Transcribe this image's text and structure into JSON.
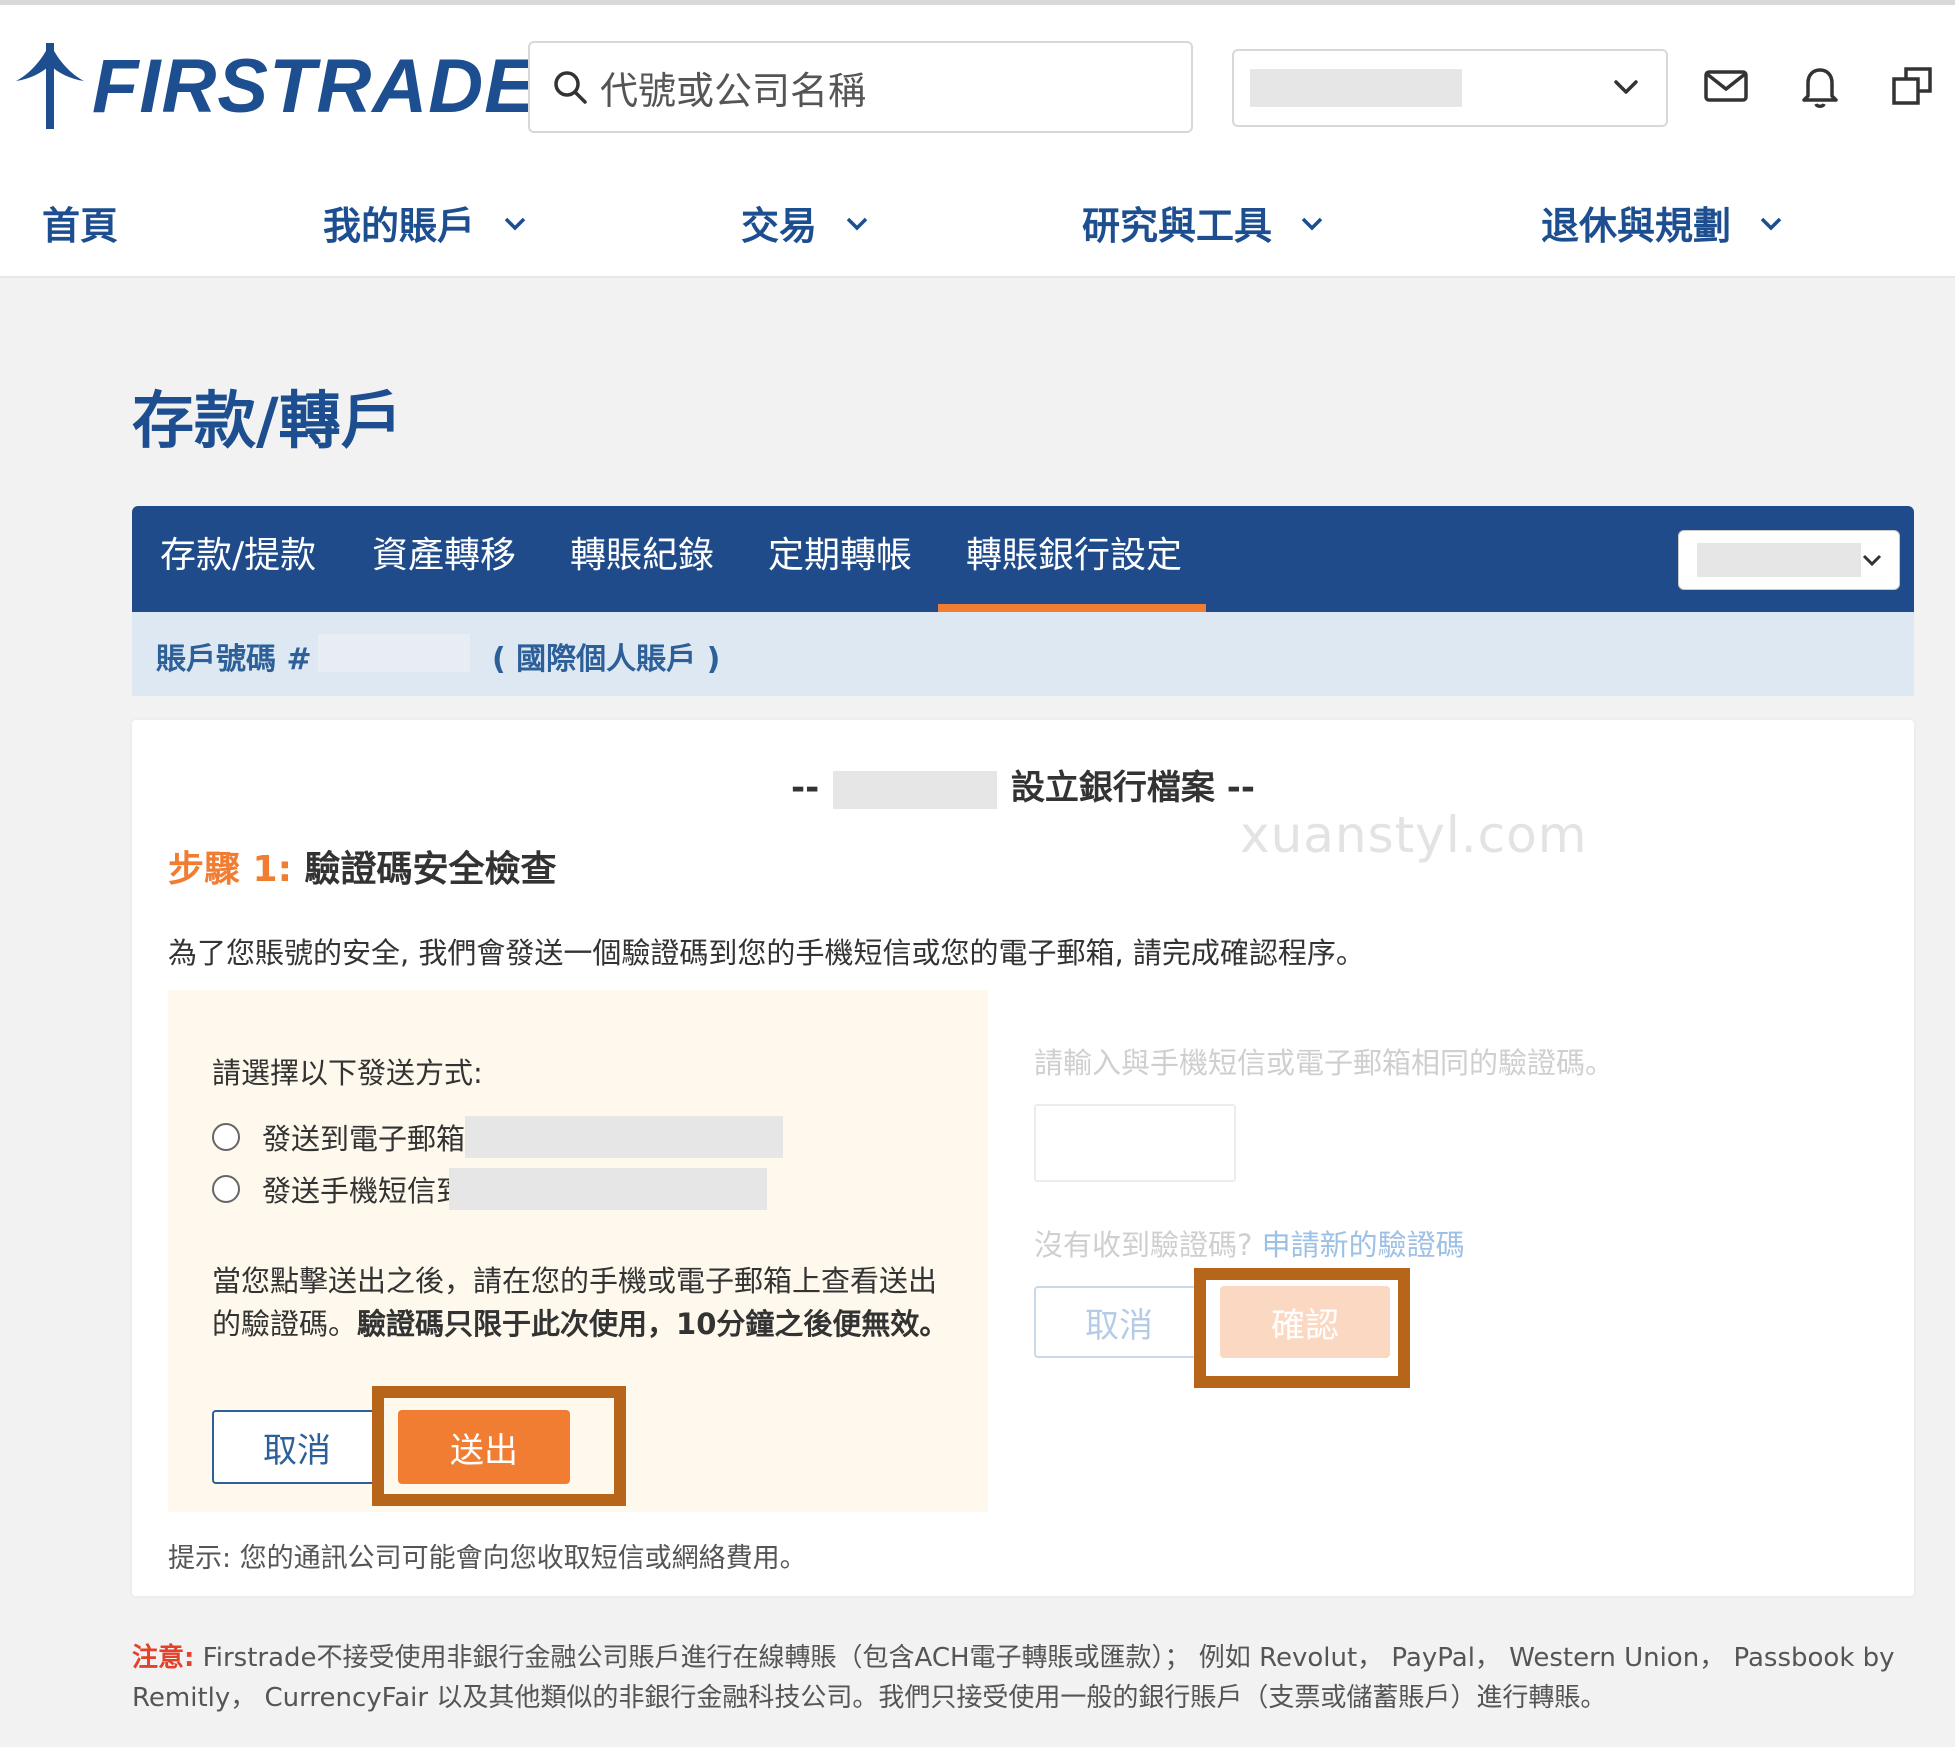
{
  "header": {
    "brand": "FIRSTRADE",
    "search_placeholder": "代號或公司名稱",
    "icons": [
      "search-icon",
      "chevron-down-icon",
      "mail-icon",
      "bell-icon",
      "external-window-icon"
    ]
  },
  "nav": [
    {
      "label": "首頁"
    },
    {
      "label": "我的賬戶"
    },
    {
      "label": "交易"
    },
    {
      "label": "研究與工具"
    },
    {
      "label": "退休與規劃"
    }
  ],
  "page": {
    "title": "存款/轉戶"
  },
  "tabs": [
    {
      "label": "存款/提款"
    },
    {
      "label": "資產轉移"
    },
    {
      "label": "轉賬紀錄"
    },
    {
      "label": "定期轉帳"
    },
    {
      "label": "轉賬銀行設定",
      "active": true
    }
  ],
  "account": {
    "label": "賬戶號碼 #",
    "type": "( 國際個人賬戶 )"
  },
  "card": {
    "heading_prefix": "--",
    "heading_suffix": "設立銀行檔案 --",
    "watermark": "xuanstyl.com",
    "step_num": "步驟 1:",
    "step_title": "驗證碼安全檢查",
    "description": "為了您賬號的安全, 我們會發送一個驗證碼到您的手機短信或您的電子郵箱, 請完成確認程序。",
    "method_title": "請選擇以下發送方式:",
    "option_email": "發送到電子郵箱",
    "option_sms": "發送手機短信到",
    "note_plain": "當您點擊送出之後，請在您的手機或電子郵箱上查看送出的驗證碼。",
    "note_bold": "驗證碼只限于此次使用，10分鐘之後便無效。",
    "cancel_label": "取消",
    "send_label": "送出",
    "code_label": "請輸入與手機短信或電子郵箱相同的驗證碼。",
    "resend_text": "沒有收到驗證碼?",
    "resend_link": "申請新的驗證碼",
    "cancel2_label": "取消",
    "confirm_label": "確認",
    "tip": "提示: 您的通訊公司可能會向您收取短信或網絡費用。"
  },
  "footer": {
    "warn_label": "注意:",
    "text": " Firstrade不接受使用非銀行金融公司賬戶進行在線轉賬（包含ACH電子轉賬或匯款）； 例如 Revolut， PayPal， Western Union， Passbook by Remitly， CurrencyFair 以及其他類似的非銀行金融科技公司。我們只接受使用一般的銀行賬戶（支票或儲蓄賬戶）進行轉賬。"
  },
  "colors": {
    "brand_blue": "#1d4e8f",
    "tab_bar": "#1f4b8a",
    "accent_orange": "#f07d32",
    "highlight_border": "#b8651c",
    "warning_red": "#e4412b"
  }
}
